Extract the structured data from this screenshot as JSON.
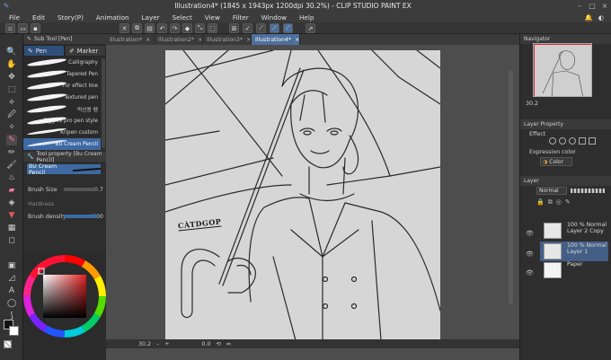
{
  "window": {
    "title": "Illustration4* (1845 x 1943px 1200dpi 30.2%) - CLIP STUDIO PAINT EX"
  },
  "menu": {
    "items": [
      "File",
      "Edit",
      "Story(P)",
      "Animation",
      "Layer",
      "Select",
      "View",
      "Filter",
      "Window",
      "Help"
    ]
  },
  "doc_tabs": [
    {
      "label": "Illustration*",
      "active": false
    },
    {
      "label": "Illustration2*",
      "active": false
    },
    {
      "label": "Illustration3*",
      "active": false
    },
    {
      "label": "Illustration4*",
      "active": true
    }
  ],
  "sub_tool": {
    "header": "Sub Tool [Pen]",
    "tabs": [
      "Pen",
      "Marker"
    ],
    "brushes": [
      {
        "label": "Calligraphy"
      },
      {
        "label": "Tapered Pen"
      },
      {
        "label": "For effect line"
      },
      {
        "label": "Textured pen"
      },
      {
        "label": "먹선용 펜"
      },
      {
        "label": "Piggies pro pen style"
      },
      {
        "label": "Kripen custom"
      },
      {
        "label": "Bu Cream Pencil"
      }
    ]
  },
  "tool_property": {
    "header": "Tool property [Bu Cream Pencil]",
    "brush_name": "BU Cream Pencil",
    "brush_size_label": "Brush Size",
    "brush_size_value": "9.7",
    "hardness_label": "Hardness",
    "brush_density_label": "Brush density",
    "brush_density_value": "100"
  },
  "navigator": {
    "header": "Navigator",
    "zoom_value": "30.2"
  },
  "layer_property": {
    "header": "Layer Property",
    "effect_label": "Effect",
    "expression_color_label": "Expression color",
    "expression_color_value": "Color"
  },
  "layers_panel": {
    "header": "Layer",
    "blend_mode": "Normal",
    "layers": [
      {
        "opacity_mode": "100 % Normal",
        "name": "Layer 2 Copy",
        "active": false
      },
      {
        "opacity_mode": "100 % Normal",
        "name": "Layer 1",
        "active": true
      },
      {
        "opacity_mode": "",
        "name": "Paper",
        "active": false
      }
    ]
  },
  "canvas": {
    "signature": "CÀTDGOP"
  },
  "status": {
    "zoom": "30.2",
    "angle": "0.0"
  },
  "colors": {
    "accent_blue": "#3e6aa3",
    "paper": "#d6d6d6",
    "navigator_frame": "#d23030"
  }
}
